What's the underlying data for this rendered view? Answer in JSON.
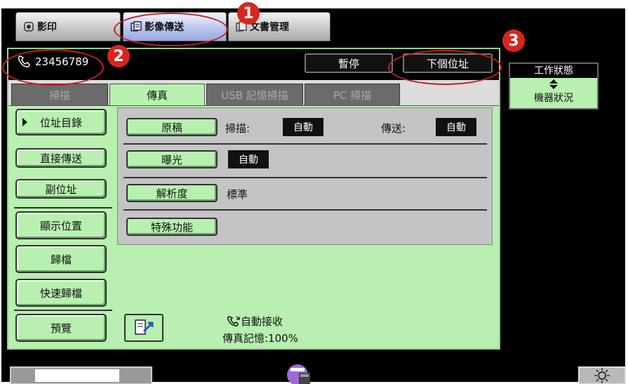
{
  "mode_tabs": [
    {
      "label": "影印",
      "icon": "copy-icon"
    },
    {
      "label": "影像傳送",
      "icon": "scanner-icon"
    },
    {
      "label": "文書管理",
      "icon": "document-server-icon"
    }
  ],
  "phone_bar": {
    "icon": "phone-icon",
    "number": "23456789"
  },
  "top_buttons": {
    "pause": "暫停",
    "next_address": "下個位址"
  },
  "status_panel": {
    "top": "工作狀態",
    "bottom": "機器狀況",
    "icon": "up-down-arrow-icon"
  },
  "func_tabs": [
    "掃描",
    "傳真",
    "USB 記憶掃描",
    "PC 掃描"
  ],
  "active_tab": "傳真",
  "side_menu": [
    "位址目錄",
    "直接傳送",
    "副位址",
    "顯示位置",
    "歸檔",
    "快速歸檔",
    "預覽"
  ],
  "settings": {
    "original": {
      "button": "原稿",
      "scan_label": "掃描:",
      "scan_value": "自動",
      "send_label": "傳送:",
      "send_value": "自動"
    },
    "exposure": {
      "button": "曝光",
      "value": "自動"
    },
    "resolution": {
      "button": "解析度",
      "value": "標準"
    },
    "special": {
      "button": "特殊功能"
    }
  },
  "bottom_info": {
    "auto_receive": "自動接收",
    "fax_memory": "傳真記憶:100%"
  },
  "callouts": [
    "1",
    "2",
    "3"
  ],
  "colors": {
    "panel_green": "#b8f0b0",
    "callout_red": "#d7261e"
  }
}
